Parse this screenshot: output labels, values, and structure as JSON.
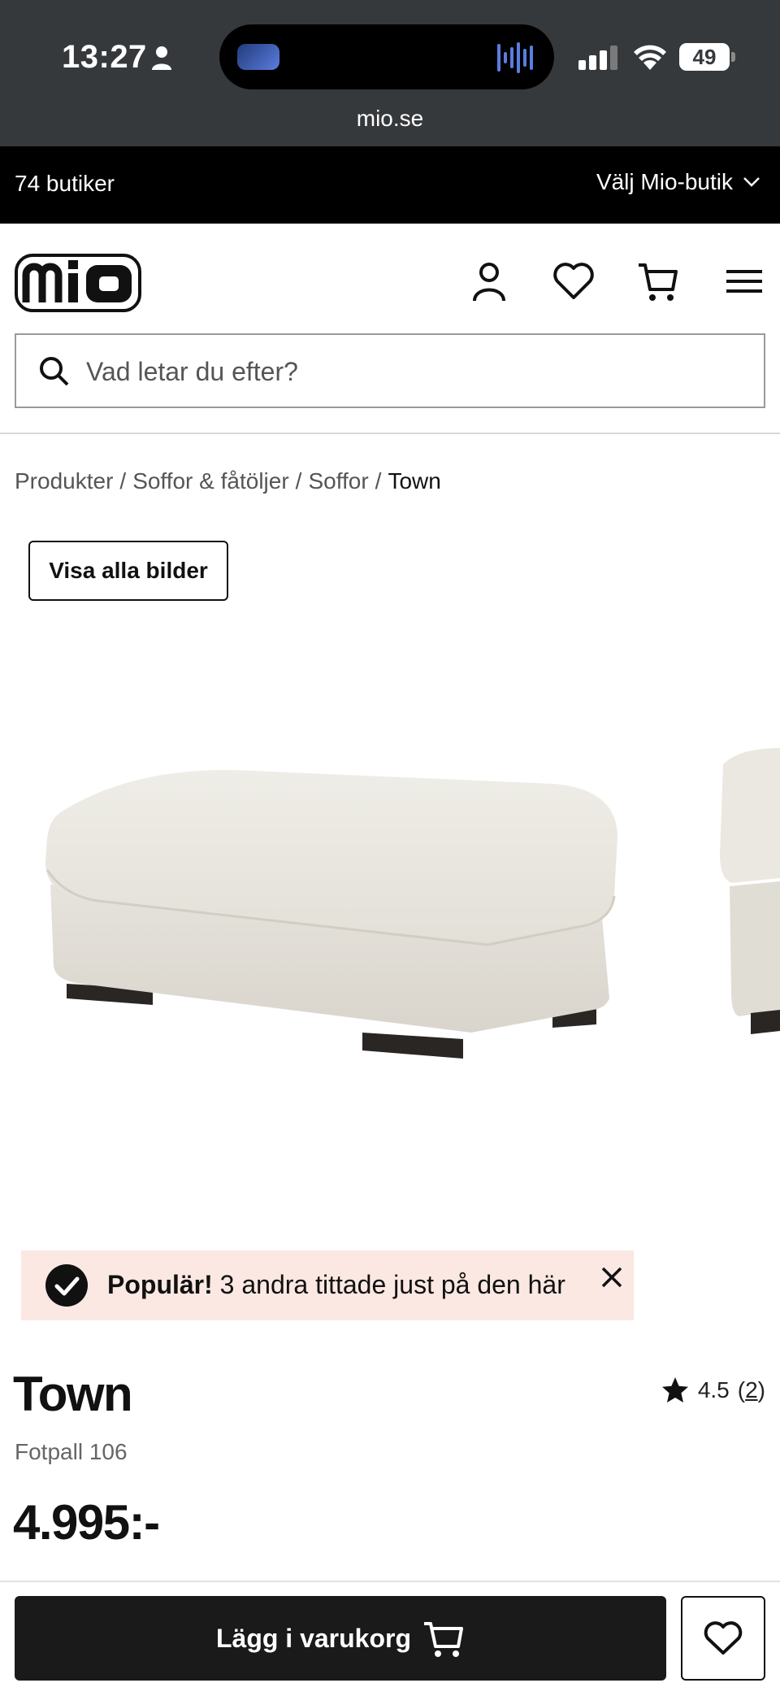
{
  "status_bar": {
    "time": "13:27",
    "battery": "49",
    "url": "mio.se"
  },
  "store_bar": {
    "count": "74 butiker",
    "select_label": "Välj Mio-butik"
  },
  "header": {
    "logo_text": "mio",
    "icons": [
      "user-icon",
      "heart-icon",
      "cart-icon",
      "menu-icon"
    ]
  },
  "search": {
    "placeholder": "Vad letar du efter?"
  },
  "breadcrumb": [
    {
      "label": "Produkter"
    },
    {
      "label": "Soffor & fåtöljer"
    },
    {
      "label": "Soffor"
    },
    {
      "label": "Town"
    }
  ],
  "gallery": {
    "show_all_label": "Visa alla bilder"
  },
  "popular_banner": {
    "bold": "Populär!",
    "text": "3 andra tittade just på den här"
  },
  "product": {
    "name": "Town",
    "variant": "Fotpall 106",
    "price": "4.995:-",
    "rating": "4.5",
    "rating_count": "2"
  },
  "actions": {
    "add_to_cart_label": "Lägg i varukorg"
  },
  "colors": {
    "store_bar_bg": "#000000",
    "status_bar_bg": "#36393c",
    "banner_bg": "#fbe8e3",
    "button_dark": "#1a1a1a"
  }
}
